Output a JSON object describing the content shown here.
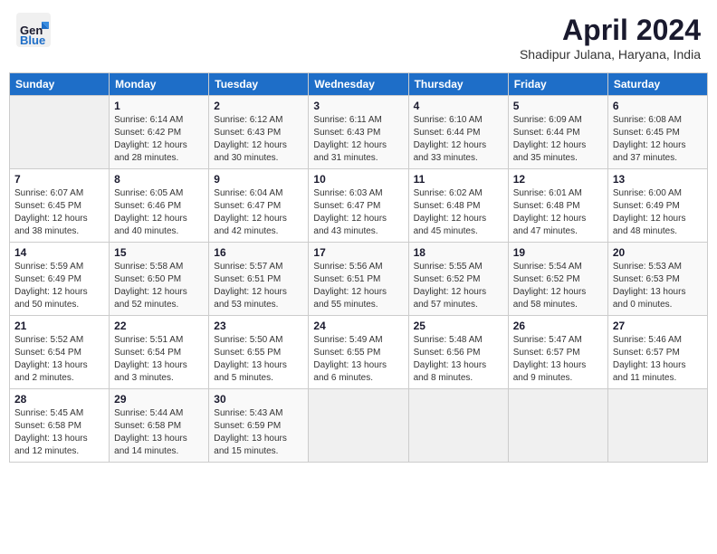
{
  "header": {
    "logo_line1": "General",
    "logo_line2": "Blue",
    "month_title": "April 2024",
    "location": "Shadipur Julana, Haryana, India"
  },
  "calendar": {
    "days_of_week": [
      "Sunday",
      "Monday",
      "Tuesday",
      "Wednesday",
      "Thursday",
      "Friday",
      "Saturday"
    ],
    "weeks": [
      [
        {
          "day": "",
          "info": ""
        },
        {
          "day": "1",
          "info": "Sunrise: 6:14 AM\nSunset: 6:42 PM\nDaylight: 12 hours\nand 28 minutes."
        },
        {
          "day": "2",
          "info": "Sunrise: 6:12 AM\nSunset: 6:43 PM\nDaylight: 12 hours\nand 30 minutes."
        },
        {
          "day": "3",
          "info": "Sunrise: 6:11 AM\nSunset: 6:43 PM\nDaylight: 12 hours\nand 31 minutes."
        },
        {
          "day": "4",
          "info": "Sunrise: 6:10 AM\nSunset: 6:44 PM\nDaylight: 12 hours\nand 33 minutes."
        },
        {
          "day": "5",
          "info": "Sunrise: 6:09 AM\nSunset: 6:44 PM\nDaylight: 12 hours\nand 35 minutes."
        },
        {
          "day": "6",
          "info": "Sunrise: 6:08 AM\nSunset: 6:45 PM\nDaylight: 12 hours\nand 37 minutes."
        }
      ],
      [
        {
          "day": "7",
          "info": "Sunrise: 6:07 AM\nSunset: 6:45 PM\nDaylight: 12 hours\nand 38 minutes."
        },
        {
          "day": "8",
          "info": "Sunrise: 6:05 AM\nSunset: 6:46 PM\nDaylight: 12 hours\nand 40 minutes."
        },
        {
          "day": "9",
          "info": "Sunrise: 6:04 AM\nSunset: 6:47 PM\nDaylight: 12 hours\nand 42 minutes."
        },
        {
          "day": "10",
          "info": "Sunrise: 6:03 AM\nSunset: 6:47 PM\nDaylight: 12 hours\nand 43 minutes."
        },
        {
          "day": "11",
          "info": "Sunrise: 6:02 AM\nSunset: 6:48 PM\nDaylight: 12 hours\nand 45 minutes."
        },
        {
          "day": "12",
          "info": "Sunrise: 6:01 AM\nSunset: 6:48 PM\nDaylight: 12 hours\nand 47 minutes."
        },
        {
          "day": "13",
          "info": "Sunrise: 6:00 AM\nSunset: 6:49 PM\nDaylight: 12 hours\nand 48 minutes."
        }
      ],
      [
        {
          "day": "14",
          "info": "Sunrise: 5:59 AM\nSunset: 6:49 PM\nDaylight: 12 hours\nand 50 minutes."
        },
        {
          "day": "15",
          "info": "Sunrise: 5:58 AM\nSunset: 6:50 PM\nDaylight: 12 hours\nand 52 minutes."
        },
        {
          "day": "16",
          "info": "Sunrise: 5:57 AM\nSunset: 6:51 PM\nDaylight: 12 hours\nand 53 minutes."
        },
        {
          "day": "17",
          "info": "Sunrise: 5:56 AM\nSunset: 6:51 PM\nDaylight: 12 hours\nand 55 minutes."
        },
        {
          "day": "18",
          "info": "Sunrise: 5:55 AM\nSunset: 6:52 PM\nDaylight: 12 hours\nand 57 minutes."
        },
        {
          "day": "19",
          "info": "Sunrise: 5:54 AM\nSunset: 6:52 PM\nDaylight: 12 hours\nand 58 minutes."
        },
        {
          "day": "20",
          "info": "Sunrise: 5:53 AM\nSunset: 6:53 PM\nDaylight: 13 hours\nand 0 minutes."
        }
      ],
      [
        {
          "day": "21",
          "info": "Sunrise: 5:52 AM\nSunset: 6:54 PM\nDaylight: 13 hours\nand 2 minutes."
        },
        {
          "day": "22",
          "info": "Sunrise: 5:51 AM\nSunset: 6:54 PM\nDaylight: 13 hours\nand 3 minutes."
        },
        {
          "day": "23",
          "info": "Sunrise: 5:50 AM\nSunset: 6:55 PM\nDaylight: 13 hours\nand 5 minutes."
        },
        {
          "day": "24",
          "info": "Sunrise: 5:49 AM\nSunset: 6:55 PM\nDaylight: 13 hours\nand 6 minutes."
        },
        {
          "day": "25",
          "info": "Sunrise: 5:48 AM\nSunset: 6:56 PM\nDaylight: 13 hours\nand 8 minutes."
        },
        {
          "day": "26",
          "info": "Sunrise: 5:47 AM\nSunset: 6:57 PM\nDaylight: 13 hours\nand 9 minutes."
        },
        {
          "day": "27",
          "info": "Sunrise: 5:46 AM\nSunset: 6:57 PM\nDaylight: 13 hours\nand 11 minutes."
        }
      ],
      [
        {
          "day": "28",
          "info": "Sunrise: 5:45 AM\nSunset: 6:58 PM\nDaylight: 13 hours\nand 12 minutes."
        },
        {
          "day": "29",
          "info": "Sunrise: 5:44 AM\nSunset: 6:58 PM\nDaylight: 13 hours\nand 14 minutes."
        },
        {
          "day": "30",
          "info": "Sunrise: 5:43 AM\nSunset: 6:59 PM\nDaylight: 13 hours\nand 15 minutes."
        },
        {
          "day": "",
          "info": ""
        },
        {
          "day": "",
          "info": ""
        },
        {
          "day": "",
          "info": ""
        },
        {
          "day": "",
          "info": ""
        }
      ]
    ]
  }
}
